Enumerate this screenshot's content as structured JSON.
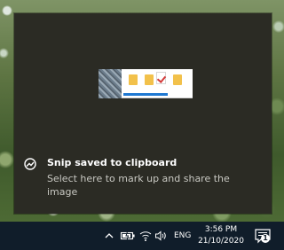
{
  "notification": {
    "title": "Snip saved to clipboard",
    "body": "Select here to mark up and share the image",
    "app_icon": "snip-sketch-icon"
  },
  "taskbar": {
    "tray_icons": [
      "chevron-up-icon",
      "battery-icon",
      "wifi-icon",
      "volume-icon"
    ],
    "language": "ENG",
    "time": "3:56 PM",
    "date": "21/10/2020",
    "action_center_icon": "action-center-icon",
    "notification_count": "1"
  },
  "colors": {
    "toast_background": "#2b2b24",
    "taskbar_background": "#101d2a",
    "accent": "#1e78d2"
  }
}
